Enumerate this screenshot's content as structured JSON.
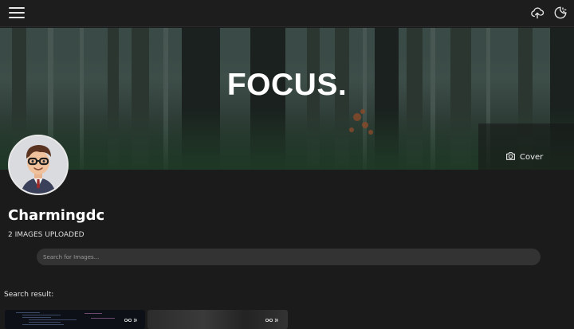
{
  "topbar": {
    "menu_icon": "hamburger-menu-icon",
    "upload_icon": "cloud-upload-icon",
    "theme_icon": "theme-toggle-icon"
  },
  "cover": {
    "title": "FOCUS.",
    "button_label": "Cover",
    "button_icon": "camera-icon"
  },
  "profile": {
    "name": "Charmingdc",
    "upload_count": "2 IMAGES UPLOADED"
  },
  "search": {
    "placeholder": "Search for Images..."
  },
  "results": {
    "label": "Search result:"
  },
  "colors": {
    "background": "#1b1b1b",
    "topbar": "#1d1d1d",
    "search_bg": "#333333"
  }
}
